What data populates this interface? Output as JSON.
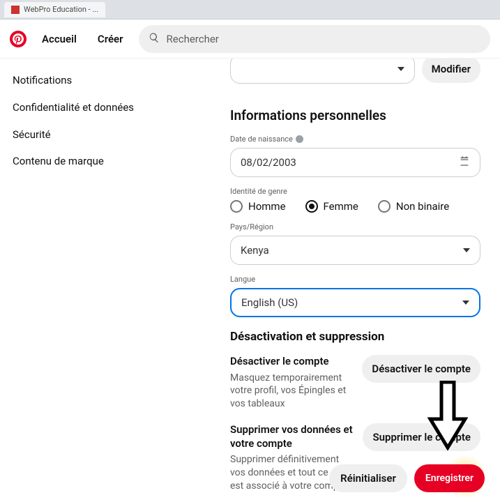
{
  "browser": {
    "tab_title": "WebPro Education - ..."
  },
  "header": {
    "logo_letter": "P",
    "home": "Accueil",
    "create": "Créer",
    "search_placeholder": "Rechercher"
  },
  "sidebar": {
    "items": [
      {
        "label": "Notifications"
      },
      {
        "label": "Confidentialité et données"
      },
      {
        "label": "Sécurité"
      },
      {
        "label": "Contenu de marque"
      }
    ]
  },
  "main": {
    "top_button": "Modifier",
    "personal_info_title": "Informations personnelles",
    "dob": {
      "label": "Date de naissance",
      "value": "08/02/2003"
    },
    "gender": {
      "label": "Identité de genre",
      "options": [
        {
          "label": "Homme",
          "selected": false
        },
        {
          "label": "Femme",
          "selected": true
        },
        {
          "label": "Non binaire",
          "selected": false
        }
      ]
    },
    "country": {
      "label": "Pays/Région",
      "value": "Kenya"
    },
    "language": {
      "label": "Langue",
      "value": "English (US)"
    },
    "deactivate_title": "Désactivation et suppression",
    "deactivate": {
      "heading": "Désactiver le compte",
      "desc": "Masquez temporairement votre profil, vos Épingles et vos tableaux",
      "button": "Désactiver le compte"
    },
    "delete": {
      "heading": "Supprimer vos données et votre compte",
      "desc": "Supprimer définitivement vos données et tout ce qui est associé à votre compte",
      "button": "Supprimer le compte"
    }
  },
  "footer": {
    "reset": "Réinitialiser",
    "save": "Enregistrer"
  }
}
